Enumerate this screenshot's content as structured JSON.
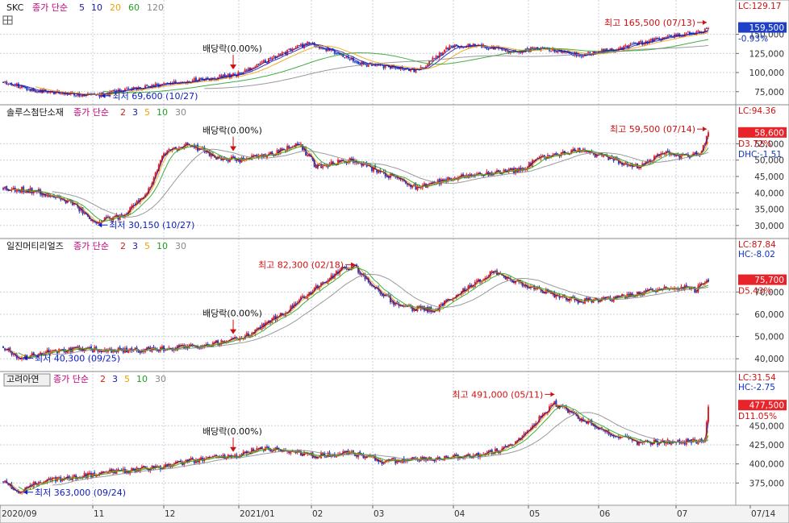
{
  "colors": {
    "up": "#e8232a",
    "down": "#1e40c8",
    "ma_5": "#1a1aa8",
    "ma_10": "#1a1aa8",
    "ma_20": "#f0a000",
    "ma_60": "#20a020",
    "ma_120": "#888888",
    "ma_2": "#cc2222",
    "ma_3": "#1a1aa8",
    "ma_30": "#888888",
    "title": "#c0007a",
    "grid": "#c8d0dc",
    "axis_bg": "#f3f3f3"
  },
  "x_axis": {
    "labels": [
      "2020/09",
      "11",
      "12",
      "2021/01",
      "02",
      "03",
      "04",
      "05",
      "06",
      "07",
      "07/14"
    ]
  },
  "panels": [
    {
      "name": "SKC",
      "ma_label": "종가 단순",
      "periods": [
        "5",
        "10",
        "20",
        "60",
        "120"
      ],
      "period_colors": [
        "#1a1aa8",
        "#1a1aa8",
        "#f0a000",
        "#20a020",
        "#888888"
      ],
      "y_ticks": [
        75000,
        100000,
        125000,
        150000
      ],
      "y_tick_labels": [
        "75,000",
        "100,000",
        "125,000",
        "150,000"
      ],
      "ylim": [
        60000,
        178000
      ],
      "lc_label": "LC:129.17",
      "price_box": "159,500",
      "change_label": "-0.93%",
      "high_label": "최고 165,500 (07/13)",
      "low_label": "최저 69,600 (10/27)",
      "dividend_label": "배당락(0.00%)",
      "start": 88000,
      "anchors": [
        [
          0,
          88000
        ],
        [
          20,
          76000
        ],
        [
          40,
          72000
        ],
        [
          55,
          70000
        ],
        [
          80,
          80000
        ],
        [
          100,
          86000
        ],
        [
          120,
          92000
        ],
        [
          140,
          98000
        ],
        [
          160,
          120000
        ],
        [
          180,
          138000
        ],
        [
          195,
          128000
        ],
        [
          210,
          112000
        ],
        [
          230,
          107000
        ],
        [
          245,
          102000
        ],
        [
          265,
          135000
        ],
        [
          280,
          136000
        ],
        [
          300,
          127000
        ],
        [
          320,
          133000
        ],
        [
          340,
          122000
        ],
        [
          360,
          130000
        ],
        [
          380,
          140000
        ],
        [
          400,
          150000
        ],
        [
          412,
          152000
        ],
        [
          417,
          160000
        ]
      ],
      "high_value": 165500,
      "low_value": 69600,
      "seed": 11
    },
    {
      "name": "솔루스첨단소재",
      "ma_label": "종가 단순",
      "periods": [
        "2",
        "3",
        "5",
        "10",
        "30"
      ],
      "period_colors": [
        "#cc2222",
        "#1a1aa8",
        "#f0a000",
        "#20a020",
        "#888888"
      ],
      "y_ticks": [
        30000,
        35000,
        40000,
        45000,
        50000,
        55000
      ],
      "y_tick_labels": [
        "30,000",
        "35,000",
        "40,000",
        "45,000",
        "50,000",
        "55,000"
      ],
      "ylim": [
        26500,
        62500
      ],
      "lc_label": "LC:94.36",
      "price_box": "58,600",
      "change_label": "D3.72%",
      "extra_label": "DHC:-1.51",
      "high_label": "최고 59,500 (07/14)",
      "low_label": "최저 30,150 (10/27)",
      "dividend_label": "배당락(0.00%)",
      "start": 41500,
      "anchors": [
        [
          0,
          41500
        ],
        [
          20,
          40500
        ],
        [
          40,
          37000
        ],
        [
          55,
          31000
        ],
        [
          70,
          33000
        ],
        [
          85,
          40000
        ],
        [
          95,
          52000
        ],
        [
          110,
          55000
        ],
        [
          125,
          51000
        ],
        [
          140,
          50000
        ],
        [
          160,
          52000
        ],
        [
          175,
          55000
        ],
        [
          185,
          48000
        ],
        [
          205,
          50000
        ],
        [
          225,
          46000
        ],
        [
          245,
          41500
        ],
        [
          265,
          44500
        ],
        [
          285,
          46000
        ],
        [
          305,
          47000
        ],
        [
          320,
          51000
        ],
        [
          340,
          53000
        ],
        [
          355,
          51000
        ],
        [
          375,
          48000
        ],
        [
          390,
          52000
        ],
        [
          400,
          51000
        ],
        [
          412,
          52000
        ],
        [
          417,
          58600
        ]
      ],
      "high_value": 59500,
      "low_value": 30150,
      "seed": 23
    },
    {
      "name": "일진머티리얼즈",
      "ma_label": "종가 단순",
      "periods": [
        "2",
        "3",
        "5",
        "10",
        "30"
      ],
      "period_colors": [
        "#cc2222",
        "#1a1aa8",
        "#f0a000",
        "#20a020",
        "#888888"
      ],
      "y_ticks": [
        40000,
        50000,
        60000,
        70000
      ],
      "y_tick_labels": [
        "40,000",
        "50,000",
        "60,000",
        "70,000"
      ],
      "ylim": [
        35000,
        87500
      ],
      "lc_label": "LC:87.84",
      "price_box": "75,700",
      "change_label": "D5.43%",
      "extra_label": "HC:-8.02",
      "high_label": "최고 82,300 (02/18)",
      "low_label": "최저 40,300 (09/25)",
      "dividend_label": "배당락(0.00%)",
      "start": 45500,
      "anchors": [
        [
          0,
          45500
        ],
        [
          10,
          40500
        ],
        [
          25,
          43000
        ],
        [
          45,
          44500
        ],
        [
          70,
          43500
        ],
        [
          100,
          44500
        ],
        [
          125,
          47000
        ],
        [
          145,
          51000
        ],
        [
          165,
          60000
        ],
        [
          185,
          72000
        ],
        [
          200,
          80000
        ],
        [
          208,
          81000
        ],
        [
          220,
          72000
        ],
        [
          235,
          63000
        ],
        [
          255,
          62000
        ],
        [
          275,
          72000
        ],
        [
          290,
          79000
        ],
        [
          305,
          74000
        ],
        [
          320,
          70000
        ],
        [
          340,
          66000
        ],
        [
          360,
          67000
        ],
        [
          380,
          70000
        ],
        [
          400,
          72000
        ],
        [
          410,
          71000
        ],
        [
          417,
          75700
        ]
      ],
      "high_value": 82300,
      "low_value": 40300,
      "seed": 37
    },
    {
      "name": "고려아연",
      "ma_label": "종가 단순",
      "periods": [
        "2",
        "3",
        "5",
        "10",
        "30"
      ],
      "period_colors": [
        "#cc2222",
        "#1a1aa8",
        "#f0a000",
        "#20a020",
        "#888888"
      ],
      "y_ticks": [
        375000,
        400000,
        425000,
        450000
      ],
      "y_tick_labels": [
        "375,000",
        "400,000",
        "425,000",
        "450,000"
      ],
      "ylim": [
        348000,
        503000
      ],
      "lc_label": "LC:31.54",
      "price_box": "477,500",
      "change_label": "D11.05%",
      "extra_label": "HC:-2.75",
      "high_label": "최고 491,000 (05/11)",
      "low_label": "최저 363,000 (09/24)",
      "dividend_label": "배당락(0.00%)",
      "start": 378000,
      "anchors": [
        [
          0,
          378000
        ],
        [
          8,
          365000
        ],
        [
          25,
          378000
        ],
        [
          50,
          385000
        ],
        [
          75,
          392000
        ],
        [
          100,
          398000
        ],
        [
          120,
          408000
        ],
        [
          140,
          412000
        ],
        [
          150,
          420000
        ],
        [
          165,
          418000
        ],
        [
          185,
          410000
        ],
        [
          205,
          415000
        ],
        [
          225,
          403000
        ],
        [
          250,
          407000
        ],
        [
          275,
          410000
        ],
        [
          295,
          418000
        ],
        [
          310,
          440000
        ],
        [
          325,
          480000
        ],
        [
          345,
          455000
        ],
        [
          360,
          438000
        ],
        [
          375,
          428000
        ],
        [
          390,
          428000
        ],
        [
          410,
          430000
        ],
        [
          415,
          432000
        ],
        [
          417,
          477500
        ]
      ],
      "high_value": 491000,
      "low_value": 363000,
      "seed": 53
    }
  ],
  "chart_data": {
    "type": "candlestick",
    "x_axis_labels": [
      "2020/09",
      "11",
      "12",
      "2021/01",
      "02",
      "03",
      "04",
      "05",
      "06",
      "07",
      "07/14"
    ],
    "series": [
      {
        "name": "SKC",
        "last": 159500,
        "change_pct": -0.93,
        "high": 165500,
        "high_date": "07/13",
        "low": 69600,
        "low_date": "10/27",
        "y_ticks": [
          75000,
          100000,
          125000,
          150000
        ]
      },
      {
        "name": "솔루스첨단소재",
        "last": 58600,
        "change_pct": 3.72,
        "high": 59500,
        "high_date": "07/14",
        "low": 30150,
        "low_date": "10/27",
        "y_ticks": [
          30000,
          35000,
          40000,
          45000,
          50000,
          55000
        ]
      },
      {
        "name": "일진머티리얼즈",
        "last": 75700,
        "change_pct": 5.43,
        "high": 82300,
        "high_date": "02/18",
        "low": 40300,
        "low_date": "09/25",
        "y_ticks": [
          40000,
          50000,
          60000,
          70000
        ]
      },
      {
        "name": "고려아연",
        "last": 477500,
        "change_pct": 11.05,
        "high": 491000,
        "high_date": "05/11",
        "low": 363000,
        "low_date": "09/24",
        "y_ticks": [
          375000,
          400000,
          425000,
          450000
        ]
      }
    ]
  }
}
